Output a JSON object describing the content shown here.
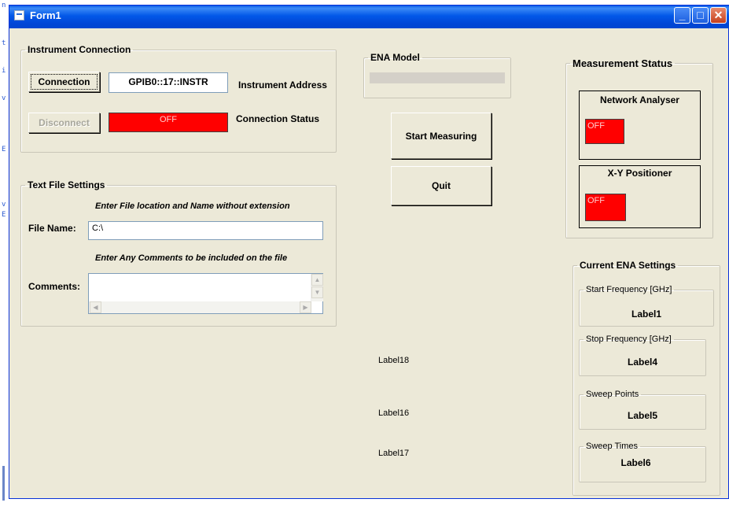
{
  "window": {
    "title": "Form1",
    "minimize_glyph": "_",
    "maximize_glyph": "□",
    "close_glyph": "✕"
  },
  "background": {
    "marks": [
      "n",
      "t",
      "i",
      "v",
      "E",
      "v",
      "E"
    ]
  },
  "instrument_connection": {
    "legend": "Instrument Connection",
    "connection_button": "Connection",
    "address_value": "GPIB0::17::INSTR",
    "address_label": "Instrument Address",
    "disconnect_button": "Disconnect",
    "status_value": "OFF",
    "status_label": "Connection Status"
  },
  "text_file_settings": {
    "legend": "Text File Settings",
    "hint_file": "Enter File location and Name without extension",
    "file_name_label": "File Name:",
    "file_name_value": "C:\\",
    "hint_comments": "Enter Any Comments to be included on the file",
    "comments_label": "Comments:",
    "comments_value": ""
  },
  "ena_model": {
    "legend": "ENA Model",
    "progress": 0
  },
  "buttons": {
    "start_measuring": "Start Measuring",
    "quit": "Quit"
  },
  "labels": {
    "label18": "Label18",
    "label16": "Label16",
    "label17": "Label17"
  },
  "measurement_status": {
    "legend": "Measurement Status",
    "network_analyser": {
      "title": "Network Analyser",
      "value": "OFF"
    },
    "xy_positioner": {
      "title": "X-Y Positioner",
      "value": "OFF"
    }
  },
  "current_ena_settings": {
    "legend": "Current ENA Settings",
    "start_frequency": {
      "legend": "Start Frequency [GHz]",
      "value": "Label1"
    },
    "stop_frequency": {
      "legend": "Stop Frequency [GHz]",
      "value": "Label4"
    },
    "sweep_points": {
      "legend": "Sweep Points",
      "value": "Label5"
    },
    "sweep_times": {
      "legend": "Sweep Times",
      "value": "Label6"
    }
  },
  "colors": {
    "status_off": "#ff0000",
    "titlebar": "#0258e8",
    "window_bg": "#ece9d8"
  }
}
